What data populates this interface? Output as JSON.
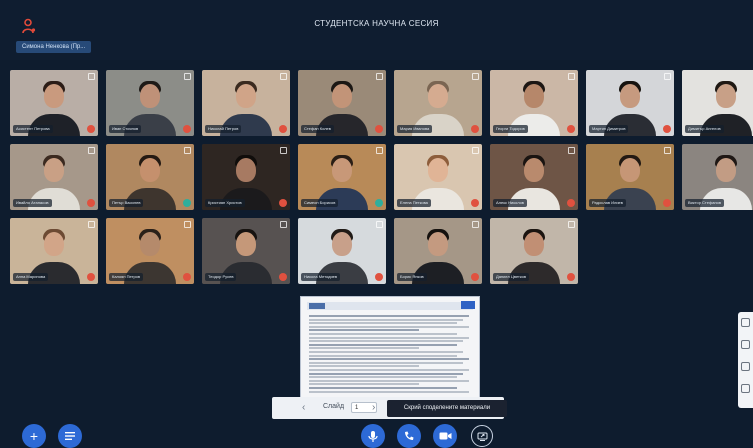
{
  "header": {
    "title": "СТУДЕНТСКА НАУЧНА СЕСИЯ",
    "presenter_chip": "Симона Ненкова (Пр..."
  },
  "participants": [
    {
      "name": "Асистент Петрова",
      "mic": "off",
      "wall": "#b9aea6",
      "shirt": "#1e2128",
      "hair": "#2b1c16",
      "skin": "#c99a7e"
    },
    {
      "name": "Иван Стоянов",
      "mic": "off",
      "wall": "#8c8d88",
      "shirt": "#3a3f48",
      "hair": "#1e1a17",
      "skin": "#bf9178"
    },
    {
      "name": "Николай Петров",
      "mic": "off",
      "wall": "#c7b29d",
      "shirt": "#2f3a4d",
      "hair": "#3a2a1f",
      "skin": "#d0a488"
    },
    {
      "name": "Стефан Колев",
      "mic": "off",
      "wall": "#9a8a78",
      "shirt": "#26262b",
      "hair": "#1b1714",
      "skin": "#c29478"
    },
    {
      "name": "Мария Иванова",
      "mic": "off",
      "wall": "#b7a58f",
      "shirt": "#d9d3c8",
      "hair": "#7a6552",
      "skin": "#d5ab90"
    },
    {
      "name": "Георги Тодоров",
      "mic": "off",
      "wall": "#cbb7a6",
      "shirt": "#ececea",
      "hair": "#1c1613",
      "skin": "#b6876a"
    },
    {
      "name": "Мартин Димитров",
      "mic": "off",
      "wall": "#d4d6d9",
      "shirt": "#2a2d34",
      "hair": "#16130f",
      "skin": "#c69a7f"
    },
    {
      "name": "Димитър Ангелов",
      "mic": "off",
      "wall": "#e3e2df",
      "shirt": "#1f2126",
      "hair": "#1e1813",
      "skin": "#c8a087"
    },
    {
      "name": "Ивайло Атанасов",
      "mic": "off",
      "wall": "#a6988a",
      "shirt": "#e0ddd6",
      "hair": "#3b2a20",
      "skin": "#c9a085"
    },
    {
      "name": "Петър Василев",
      "mic": "on",
      "wall": "#b08860",
      "shirt": "#3e352e",
      "hair": "#241a13",
      "skin": "#c5906d"
    },
    {
      "name": "Кристиян Христов",
      "mic": "off",
      "wall": "#2e2622",
      "shirt": "#1b1a1c",
      "hair": "#100d0b",
      "skin": "#a77a62"
    },
    {
      "name": "Симеон Борисов",
      "mic": "on",
      "wall": "#b88a58",
      "shirt": "#2c3b57",
      "hair": "#2a1e15",
      "skin": "#c89878"
    },
    {
      "name": "Елена Петкова",
      "mic": "off",
      "wall": "#d9c6b0",
      "shirt": "#eae6df",
      "hair": "#8d5d3b",
      "skin": "#e0b496"
    },
    {
      "name": "Алекс Николов",
      "mic": "off",
      "wall": "#6e5546",
      "shirt": "#e9e6e0",
      "hair": "#1a1411",
      "skin": "#b98a6d"
    },
    {
      "name": "Радослав Илиев",
      "mic": "off",
      "wall": "#a7804f",
      "shirt": "#3a4250",
      "hair": "#221913",
      "skin": "#c69676"
    },
    {
      "name": "Виктор Стефанов",
      "mic": "off",
      "wall": "#8b8580",
      "shirt": "#e7e7e5",
      "hair": "#1f1815",
      "skin": "#c29c84"
    },
    {
      "name": "Анна Маринова",
      "mic": "off",
      "wall": "#c9b499",
      "shirt": "#2a2b2f",
      "hair": "#6c4a33",
      "skin": "#d2a588"
    },
    {
      "name": "Калоян Петров",
      "mic": "off",
      "wall": "#bf8f61",
      "shirt": "#3c3631",
      "hair": "#2a2019",
      "skin": "#b58a6b"
    },
    {
      "name": "Теодор Русев",
      "mic": "off",
      "wall": "#575251",
      "shirt": "#2a2c31",
      "hair": "#171310",
      "skin": "#c59879"
    },
    {
      "name": "Никола Методиев",
      "mic": "off",
      "wall": "#d6dadd",
      "shirt": "#3a3d43",
      "hair": "#211b17",
      "skin": "#c8a08a"
    },
    {
      "name": "Борис Янков",
      "mic": "off",
      "wall": "#a59787",
      "shirt": "#1d1f24",
      "hair": "#15110e",
      "skin": "#c49a80"
    },
    {
      "name": "Даниел Цветков",
      "mic": "off",
      "wall": "#c1b6a9",
      "shirt": "#2d2a2b",
      "hair": "#1b1410",
      "skin": "#c18f74"
    }
  ],
  "presentation": {
    "slide_label": "Слайд",
    "page_value": "1",
    "tooltip": "Скрий споделените материали"
  },
  "controls": {
    "add_label": "+",
    "camera_label": "■"
  },
  "colors": {
    "background": "#0e1c2e",
    "accent": "#2d6ad6",
    "mic_off": "#e0513f",
    "mic_on": "#2fae9c"
  }
}
